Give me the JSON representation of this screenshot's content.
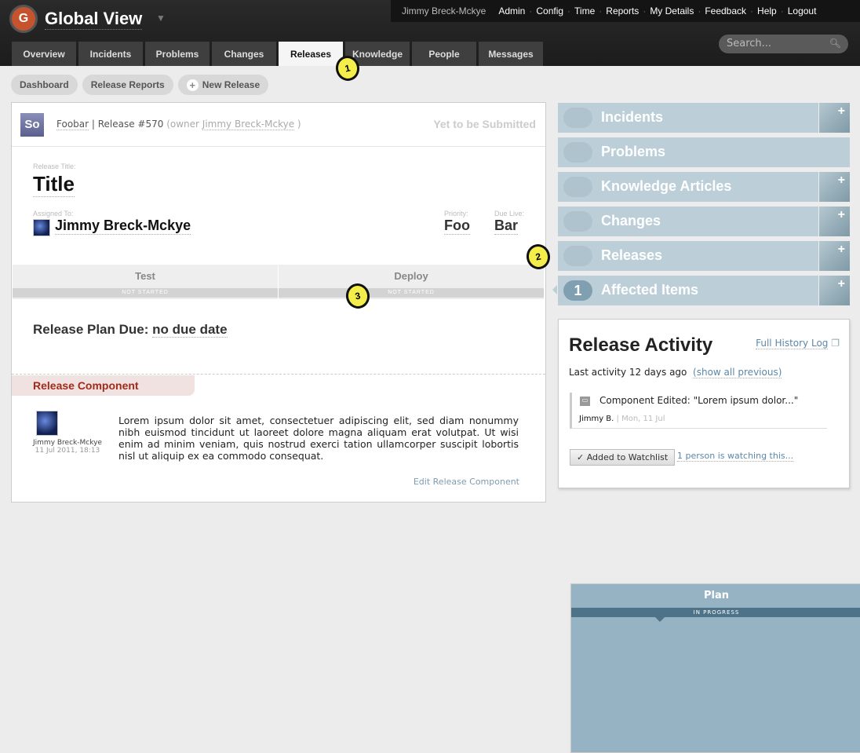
{
  "app": {
    "logo_letter": "G",
    "title": "Global View"
  },
  "topbar": {
    "user": "Jimmy Breck-Mckye",
    "links": [
      "Admin",
      "Config",
      "Time",
      "Reports",
      "My Details",
      "Feedback",
      "Help",
      "Logout"
    ]
  },
  "tabs": [
    {
      "label": "Overview",
      "w": 82
    },
    {
      "label": "Incidents",
      "w": 82
    },
    {
      "label": "Problems",
      "w": 82
    },
    {
      "label": "Changes",
      "w": 82
    },
    {
      "label": "Releases",
      "w": 82,
      "active": true
    },
    {
      "label": "Knowledge",
      "w": 82
    },
    {
      "label": "People",
      "w": 82
    },
    {
      "label": "Messages",
      "w": 82
    }
  ],
  "search": {
    "placeholder": "Search..."
  },
  "subnav": {
    "dashboard": "Dashboard",
    "reports": "Release Reports",
    "new": "New Release"
  },
  "release": {
    "badge": "So",
    "project": "Foobar",
    "sep": " | ",
    "number": "Release #570",
    "owner_prefix": " (owner ",
    "owner": "Jimmy Breck-Mckye",
    "owner_suffix": " )",
    "status": "Yet to be Submitted",
    "title_label": "Release Title:",
    "title": "Title",
    "assigned_label": "Assigned To:",
    "assigned": "Jimmy Breck-Mckye",
    "priority_label": "Priority:",
    "priority": "Foo",
    "due_label": "Due Live:",
    "due": "Bar",
    "stages": [
      {
        "name": "Plan",
        "status": "IN PROGRESS",
        "active": true
      },
      {
        "name": "Test",
        "status": "NOT STARTED"
      },
      {
        "name": "Deploy",
        "status": "NOT STARTED"
      }
    ],
    "plan_due_label": "Release Plan Due: ",
    "plan_due": "no due date"
  },
  "component": {
    "heading": "Release Component",
    "author": "Jimmy Breck-Mckye",
    "date": "11 Jul 2011, 18:13",
    "text": "Lorem ipsum dolor sit amet, consectetuer adipiscing elit, sed diam nonummy nibh euismod tincidunt ut laoreet dolore magna aliquam erat volutpat. Ut wisi enim ad minim veniam, quis nostrud exerci tation ullamcorper suscipit lobortis nisl ut aliquip ex ea commodo consequat.",
    "edit": "Edit Release Component"
  },
  "relations": [
    {
      "label": "Incidents",
      "count": "",
      "add": true
    },
    {
      "label": "Problems",
      "count": "",
      "add": false
    },
    {
      "label": "Knowledge Articles",
      "count": "",
      "add": true
    },
    {
      "label": "Changes",
      "count": "",
      "add": true
    },
    {
      "label": "Releases",
      "count": "",
      "add": true
    },
    {
      "label": "Affected Items",
      "count": "1",
      "add": true
    }
  ],
  "activity": {
    "title": "Release Activity",
    "full_log": "Full History Log",
    "last": "Last activity 12 days ago",
    "show_all": "(show all previous)",
    "entry_text": "Component Edited: \"Lorem ipsum dolor...\"",
    "entry_user": "Jimmy B.",
    "entry_date": " | Mon, 11 Jul",
    "watch_button": "✓ Added to Watchlist",
    "watching": "1 person is watching this..."
  },
  "annotations": [
    "1",
    "2",
    "3"
  ]
}
